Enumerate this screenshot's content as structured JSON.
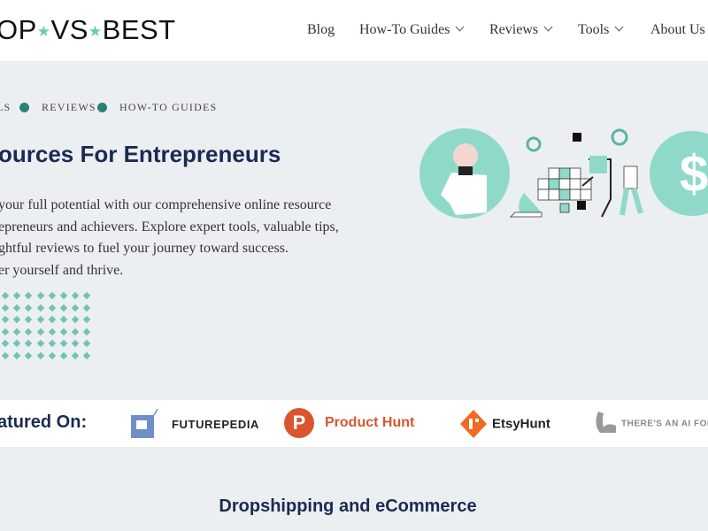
{
  "header": {
    "logo": {
      "part1": "OP",
      "star": "★",
      "part2": "VS",
      "part3": "BEST"
    },
    "nav": [
      {
        "label": "Blog",
        "dropdown": false
      },
      {
        "label": "How-To Guides",
        "dropdown": true
      },
      {
        "label": "Reviews",
        "dropdown": true
      },
      {
        "label": "Tools",
        "dropdown": true
      },
      {
        "label": "About Us",
        "dropdown": false
      }
    ]
  },
  "hero": {
    "breadcrumb": [
      "LS",
      "REVIEWS",
      "HOW-TO GUIDES"
    ],
    "title": "ources For Entrepreneurs",
    "paragraph": [
      "your full potential with our comprehensive online resource",
      "epreneurs and achievers. Explore expert tools, valuable tips,",
      "ghtful reviews to fuel your journey toward success.",
      "er yourself and thrive."
    ],
    "dollar": "$"
  },
  "featured": {
    "label": "atured On:",
    "logos": [
      {
        "name": "FUTUREPEDIA",
        "color": "#222"
      },
      {
        "name": "Product Hunt",
        "color": "#da552f"
      },
      {
        "name": "EtsyHunt",
        "color": "#222"
      },
      {
        "name": "THERE'S AN AI FOR",
        "color": "#888"
      }
    ]
  },
  "section": {
    "title": "Dropshipping and eCommerce"
  },
  "colors": {
    "accent": "#2a8274",
    "mint": "#8fd9cb",
    "navy": "#1b2a52"
  }
}
